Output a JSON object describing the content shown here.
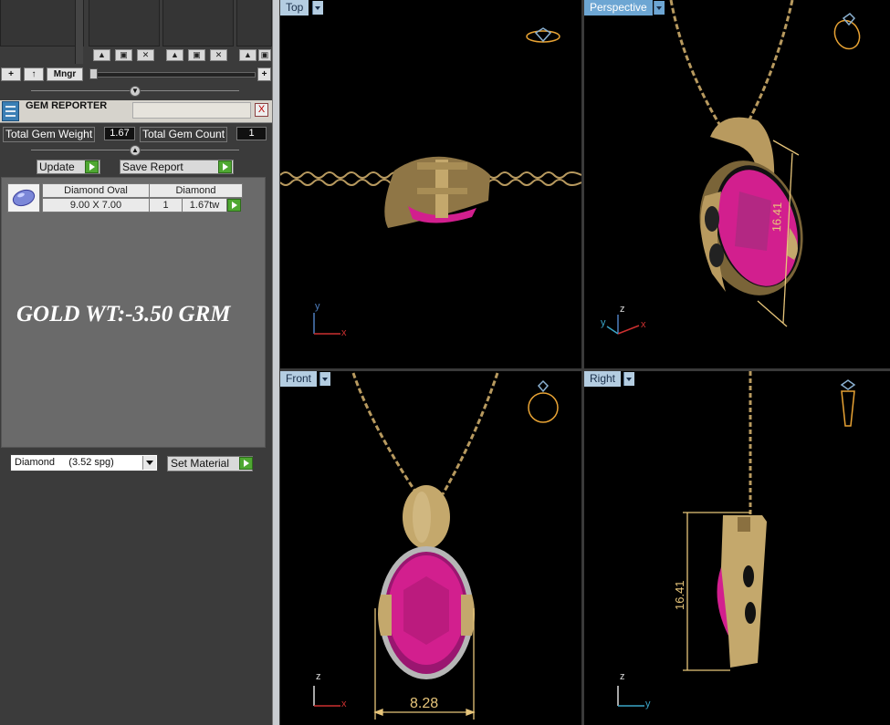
{
  "left_panel": {
    "toolbar": {
      "add": "+",
      "up": "↑",
      "manager": "Mngr",
      "add_right": "+"
    },
    "gem_reporter": {
      "title": "GEM REPORTER",
      "close": "X",
      "total_weight_label": "Total Gem Weight",
      "total_weight_value": "1.67",
      "total_count_label": "Total Gem Count",
      "total_count_value": "1",
      "update_label": "Update",
      "save_report_label": "Save Report",
      "table": {
        "headers": [
          "Diamond Oval",
          "Diamond"
        ],
        "row": {
          "size": "9.00 X 7.00",
          "count": "1",
          "weight": "1.67tw"
        }
      }
    },
    "gold_weight_text": "GOLD WT:-3.50 GRM",
    "material": {
      "selected": "Diamond     (3.52 spg)",
      "set_label": "Set Material"
    }
  },
  "viewports": {
    "top": {
      "label": "Top"
    },
    "perspective": {
      "label": "Perspective",
      "dimension": "16.41"
    },
    "front": {
      "label": "Front",
      "dimension": "8.28"
    },
    "right": {
      "label": "Right",
      "dimension": "16.41"
    }
  },
  "axes": {
    "x": "x",
    "y": "y",
    "z": "z"
  },
  "colors": {
    "gold": "#c4a86c",
    "gem": "#d21f8e",
    "dim_line": "#e7c57a",
    "viewport_bg": "#000000",
    "label_bg": "#b4cde1",
    "active_label_bg": "#6da6d3"
  }
}
